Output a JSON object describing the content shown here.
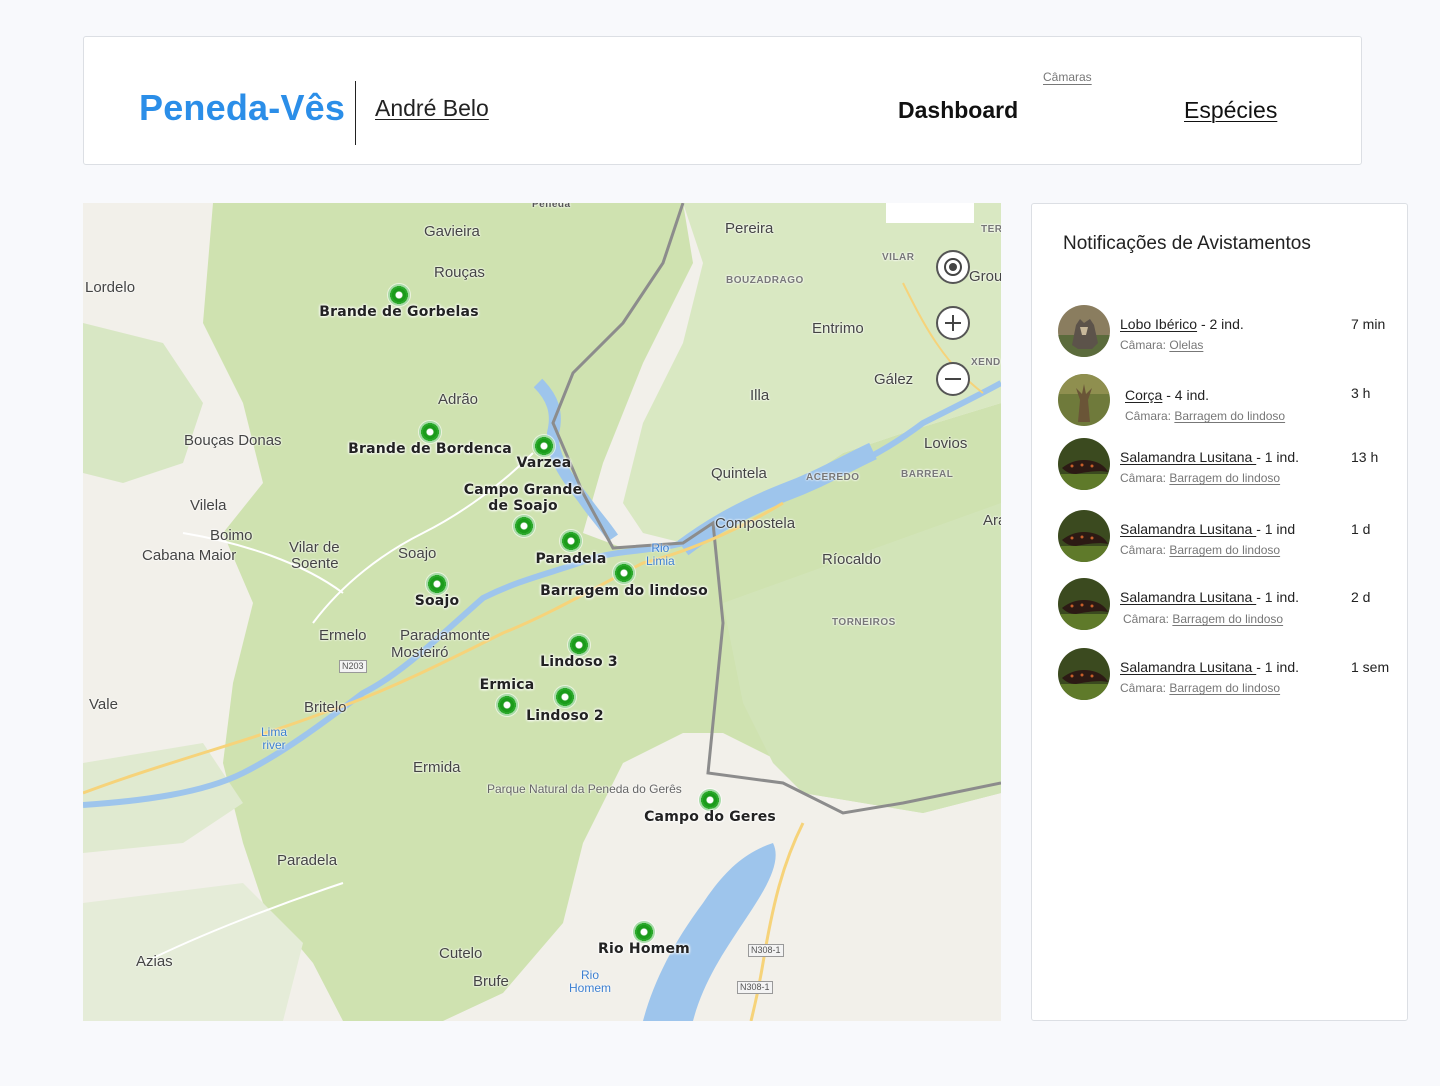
{
  "header": {
    "brand": "Peneda-Vês",
    "user": "André Belo",
    "nav": {
      "dashboard": "Dashboard",
      "cameras": "Câmaras",
      "species": "Espécies"
    }
  },
  "map": {
    "places": {
      "gavieira": "Gavieira",
      "roucas": "Rouças",
      "lordelo": "Lordelo",
      "pereira": "Pereira",
      "bouzadrago": "BOUZADRAGO",
      "vilar": "VILAR",
      "ter": "TER",
      "grou": "Grou",
      "entrimo": "Entrimo",
      "xend": "XEND",
      "galez": "Gález",
      "illa": "Illa",
      "lovios": "Lovios",
      "adrao": "Adrão",
      "boucas": "Bouças Donas",
      "vilela": "Vilela",
      "boimo": "Boimo",
      "cabana": "Cabana Maior",
      "vilarsoente1": "Vilar de",
      "vilarsoente2": "Soente",
      "soajo_town": "Soajo",
      "quintela": "Quintela",
      "acaredo": "ACEREDO",
      "barreal": "BARREAL",
      "compostela": "Compostela",
      "riocaldo": "Ríocaldo",
      "ara": "Ara",
      "torneiros": "TORNEIROS",
      "ermelo": "Ermelo",
      "paradamonte": "Paradamonte",
      "mosteiro": "Mosteiró",
      "vale": "Vale",
      "britelo": "Britelo",
      "ermida": "Ermida",
      "paradela": "Paradela",
      "azias": "Azias",
      "cutelo": "Cutelo",
      "brufe": "Brufe",
      "peneda": "Peneda",
      "park": "Parque Natural da Peneda do Gerês",
      "rio_limia1": "Rio",
      "rio_limia2": "Limia",
      "lima1": "Lima",
      "lima2": "river",
      "rio_homem1": "Rio",
      "rio_homem2": "Homem",
      "n203": "N203",
      "n308a": "N308-1",
      "n308b": "N308-1"
    },
    "cameras": [
      {
        "label": "Brande de Gorbelas"
      },
      {
        "label": "Brande de Bordenca"
      },
      {
        "label": "Varzea"
      },
      {
        "label": "Campo Grande de Soajo"
      },
      {
        "label": "Paradela"
      },
      {
        "label": "Barragem do lindoso"
      },
      {
        "label": "Soajo"
      },
      {
        "label": "Lindoso 3"
      },
      {
        "label": "Ermica"
      },
      {
        "label": "Lindoso 2"
      },
      {
        "label": "Campo do Geres"
      },
      {
        "label": "Rio Homem"
      }
    ]
  },
  "notifications": {
    "title": "Notificações de Avistamentos",
    "camera_prefix": "Câmara: ",
    "items": [
      {
        "species": "Lobo Ibérico",
        "count": " - 2 ind.",
        "camera": "Olelas",
        "time": "7 min",
        "avatar": "wolf-icon"
      },
      {
        "species": "Corça",
        "count": " - 4 ind.",
        "camera": "Barragem do lindoso",
        "time": "3 h",
        "avatar": "deer-icon"
      },
      {
        "species": "Salamandra Lusitana ",
        "count": "- 1 ind.",
        "camera": "Barragem do lindoso",
        "time": "13 h",
        "avatar": "salamander-icon"
      },
      {
        "species": "Salamandra Lusitana ",
        "count": "- 1 ind",
        "camera": "Barragem do lindoso",
        "time": "1 d",
        "avatar": "salamander-icon"
      },
      {
        "species": "Salamandra Lusitana ",
        "count": "- 1 ind.",
        "camera": "Barragem do lindoso",
        "time": "2 d",
        "avatar": "salamander-icon"
      },
      {
        "species": "Salamandra Lusitana ",
        "count": "- 1 ind.",
        "camera": "Barragem do lindoso",
        "time": "1 sem",
        "avatar": "salamander-icon"
      }
    ]
  },
  "colors": {
    "brand": "#2b8ee8",
    "marker": "#1b9b1b",
    "park": "#cfe2b0",
    "water": "#9ec5ec"
  }
}
